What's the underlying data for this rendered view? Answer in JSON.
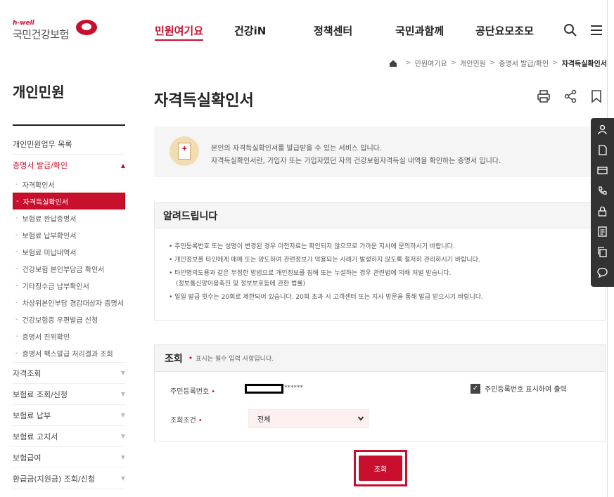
{
  "header": {
    "logo_small": "h-well",
    "logo_main": "국민건강보험",
    "nav": [
      "민원여기요",
      "건강iN",
      "정책센터",
      "국민과함께",
      "공단요모조모"
    ],
    "nav_active": "민원여기요"
  },
  "breadcrumb": [
    "민원여기요",
    "개인민원",
    "증명서 발급/확인",
    "자격득실확인서"
  ],
  "sidebar": {
    "title": "개인민원",
    "top_item": "개인민원업무 목록",
    "open_group": "증명서 발급/확인",
    "sub_items": [
      "자격확인서",
      "자격득실확인서",
      "보험료 완납증명서",
      "보험료 납부확인서",
      "보험료 미납내역서",
      "건강보험 본인부담금 확인서",
      "기타징수금 납부확인서",
      "차상위본인부담 경감대상자 증명서",
      "건강보험증 우편발급 신청",
      "증명서 진위확인",
      "증명서 팩스발급 처리결과 조회"
    ],
    "active_sub": "자격득실확인서",
    "groups": [
      "자격조회",
      "보험료 조회/신청",
      "보험료 납부",
      "보험료 고지서",
      "보험급여",
      "환급금(지원금) 조회/신청"
    ]
  },
  "main": {
    "title": "자격득실확인서",
    "info_line1": "본인의 자격득실확인서를 발급받을 수 있는 서비스 입니다.",
    "info_line2": "자격득실확인서란, 가입자 또는 가입자였던 자의 건강보험자격득실 내역을 확인하는 증명서 입니다.",
    "notice_title": "알려드립니다",
    "notice_items": [
      "• 주민등록번호 또는 성명이 변경된 경우 이전자료는 확인되지 않으므로 가까운 지사에 문의하시기 바랍니다.",
      "• 개인정보를 타인에게 매매 또는 양도하여 관련정보가 악용되는 사례가 발생하지 않도록 철저히 관리하시기 바랍니다.",
      "• 타인명의도용과 같은 부정한 방법으로 개인정보를 침해 또는 누설하는 경우 관련법에 의해 처벌 받습니다.",
      "(정보통신망이용촉진 및 정보보호등에 관한 법률)",
      "• 일일 발급 횟수는 20회로 제한되어 있습니다. 20회 초과 시 고객센터 또는 지사 방문을 통해 발급 받으시기 바랍니다."
    ],
    "query": {
      "title": "조회",
      "required_mark": "•",
      "required_note": "표시는 필수 입력 사항입니다.",
      "rrn_label": "주민등록번호",
      "rrn_masked": "******",
      "rrn_checkbox_label": "주민등록번호 표시하여 출력",
      "rrn_checkbox_checked": true,
      "condition_label": "조회조건",
      "condition_value": "전체",
      "submit_label": "조회"
    }
  },
  "colors": {
    "brand": "#c8102e",
    "panel_bg": "#f5f5f5",
    "quick_bg": "#333333"
  },
  "icons": {
    "header": [
      "search-icon",
      "menu-icon"
    ],
    "tools": [
      "print-icon",
      "share-icon",
      "bookmark-icon"
    ],
    "quick_menu": [
      "user-icon",
      "document-icon",
      "card-icon",
      "phone-icon",
      "lock-icon",
      "form-icon",
      "copy-icon",
      "chat-icon"
    ]
  }
}
